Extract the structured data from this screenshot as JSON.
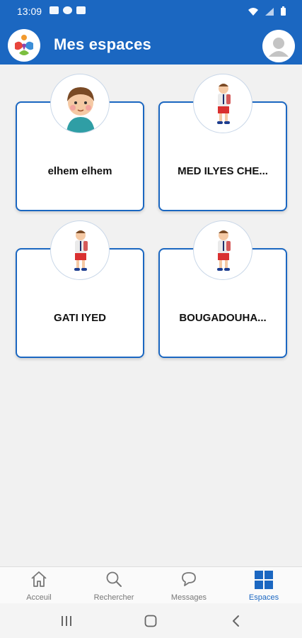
{
  "status_bar": {
    "time": "13:09"
  },
  "header": {
    "title": "Mes espaces"
  },
  "spaces": [
    {
      "name": "elhem elhem",
      "avatar": "child-face-avatar"
    },
    {
      "name": "MED ILYES CHE...",
      "avatar": "schoolboy-avatar"
    },
    {
      "name": "GATI IYED",
      "avatar": "schoolboy-avatar"
    },
    {
      "name": "BOUGADOUHA...",
      "avatar": "schoolboy-avatar"
    }
  ],
  "bottom_nav": {
    "items": [
      {
        "label": "Acceuil",
        "icon": "home-icon"
      },
      {
        "label": "Rechercher",
        "icon": "search-icon"
      },
      {
        "label": "Messages",
        "icon": "chat-icon"
      },
      {
        "label": "Espaces",
        "icon": "grid-icon",
        "active": true
      }
    ]
  },
  "colors": {
    "primary": "#1b67c1",
    "background": "#f1f1f1",
    "inactive": "#777777"
  }
}
